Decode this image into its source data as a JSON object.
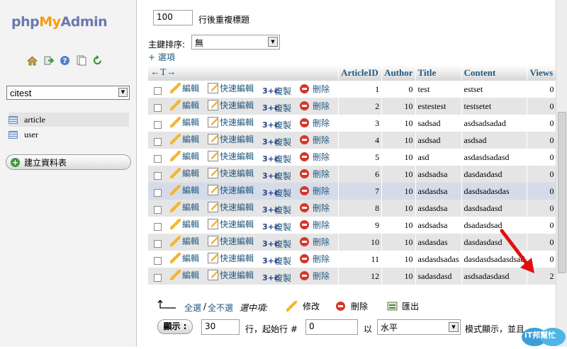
{
  "nav": {
    "logo_php": "php",
    "logo_my": "My",
    "logo_admin": "Admin",
    "icons": [
      "home-icon",
      "exit-icon",
      "help-icon",
      "docs-icon",
      "reload-icon"
    ],
    "database": "citest",
    "tables": [
      "article",
      "user"
    ],
    "create_table": "建立資料表"
  },
  "controls": {
    "repeat_value": "100",
    "repeat_label": "行後重複標題",
    "sort_label": "主鍵排序:",
    "sort_value": "無",
    "options_link": "+ 選項"
  },
  "table": {
    "arrows": "←T→",
    "columns": [
      "ArticleID",
      "Author",
      "Title",
      "Content",
      "Views"
    ],
    "actions": {
      "edit": "編輯",
      "quick_edit": "快速編輯",
      "copy": "複製",
      "delete": "刪除"
    },
    "rows": [
      {
        "id": "1",
        "author": "0",
        "title": "test",
        "content": "estset",
        "views": "0"
      },
      {
        "id": "2",
        "author": "10",
        "title": "estestest",
        "content": "testsetet",
        "views": "0"
      },
      {
        "id": "3",
        "author": "10",
        "title": "sadsad",
        "content": "asdsadsadad",
        "views": "0"
      },
      {
        "id": "4",
        "author": "10",
        "title": "asdsad",
        "content": "asdsad",
        "views": "0"
      },
      {
        "id": "5",
        "author": "10",
        "title": "asd",
        "content": "asdasdsadasd",
        "views": "0"
      },
      {
        "id": "6",
        "author": "10",
        "title": "asdsadsa",
        "content": "dasdasdasd",
        "views": "0"
      },
      {
        "id": "7",
        "author": "10",
        "title": "asdasdsa",
        "content": "dasdsadasdas",
        "views": "0"
      },
      {
        "id": "8",
        "author": "10",
        "title": "asdasdsa",
        "content": "dasdsadasd",
        "views": "0"
      },
      {
        "id": "9",
        "author": "10",
        "title": "asdsadsa",
        "content": "dsadasdsad",
        "views": "0"
      },
      {
        "id": "10",
        "author": "10",
        "title": "asdasdas",
        "content": "dasdasdasd",
        "views": "0"
      },
      {
        "id": "11",
        "author": "10",
        "title": "asdasdsadas",
        "content": "dasdasdsadasdsad",
        "views": "0"
      },
      {
        "id": "12",
        "author": "10",
        "title": "sadasdasd",
        "content": "asdsadasdasd",
        "views": "2"
      }
    ]
  },
  "bulk": {
    "select_all": "全選",
    "sep": "/",
    "select_none": "全不選",
    "hint": "選中項:",
    "edit": "修改",
    "delete": "刪除",
    "export": "匯出"
  },
  "pager": {
    "show_button": "顯示 :",
    "rows_value": "30",
    "start_label": "行，起始行 #",
    "start_value": "0",
    "mode_prefix": "以",
    "mode_value": "水平",
    "mode_suffix": "模式顯示，並且"
  },
  "watermark": "iT邦幫忙"
}
